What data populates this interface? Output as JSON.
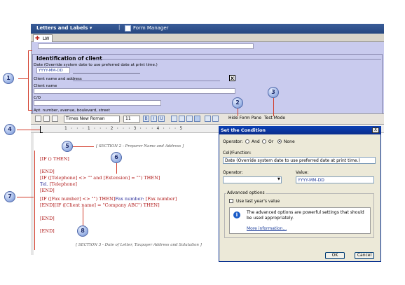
{
  "window": {
    "app_title": "Letters and Labels",
    "app_menu_arrow": "▾",
    "separator": "|",
    "form_manager": "Form Manager"
  },
  "tabs": [
    {
      "label": "LW"
    }
  ],
  "form": {
    "section_title": "Identification of client",
    "date_label": "Date (Override system date to use preferred date at print time.)",
    "date_value": "YYYY-MM-DD",
    "client_name_address_label": "Client name and address",
    "x_label": "X",
    "client_name_label": "Client name",
    "co_label": "C/O",
    "apt_label": "Apt. number, avenue, boulevard, street"
  },
  "toolbar": {
    "font": "Times New Roman",
    "size": "11",
    "bold": "B",
    "italic": "I",
    "underline": "U",
    "hide_form_pane": "Hide Form Pane",
    "test_mode": "Test Mode"
  },
  "ruler": {
    "marks": "1 · · · 1 · · · 2 · · · 3 · · · 4 · · · 5"
  },
  "editor": {
    "section2": "[ SECTION 2 - Preparer Name and Address ]",
    "line_if_empty": "[IF () THEN]",
    "end1": "[END]",
    "line_if_phone_a": "[IF ([Telephone] <> \"\" and [Extension] = \"\") THEN]",
    "tel_prefix": "Tel. ",
    "tel_field": "[Telephone]",
    "end2": "[END]",
    "line_if_fax_a": "[IF ([Fax number] <> \"\") THEN]",
    "fax_text": "Fax number: ",
    "fax_field": "[Fax number]",
    "line_end_if_client": "[END][IF ([Client name] = \"Company ABC\") THEN]",
    "end3": "[END]",
    "end4": "[END]",
    "section3": "[ SECTION 3 - Date of Letter, Taxpayer Address and Salutation ]"
  },
  "dialog": {
    "title": "Set the Condition",
    "close": "X",
    "operator_label": "Operator:",
    "op_and": "And",
    "op_or": "Or",
    "op_none": "None",
    "cell_label": "Cell/Function:",
    "cell_value": "Date (Override system date to use preferred date at print time.)",
    "operator_field_label": "Operator:",
    "operator_value": "",
    "value_label": "Value:",
    "value_value": "YYYY-MM-DD",
    "advanced_title": "Advanced options",
    "use_last_year": "Use last year's value",
    "info_text": "The advanced options are powerful settings that should be used appropriately.",
    "more_info": "More information...",
    "ok": "OK",
    "cancel": "Cancel"
  },
  "callouts": [
    "1",
    "2",
    "3",
    "4",
    "5",
    "6",
    "7",
    "8"
  ],
  "colors": {
    "accent_red": "#d23b2a",
    "form_bg": "#c9cbee",
    "title_blue": "#264780"
  }
}
